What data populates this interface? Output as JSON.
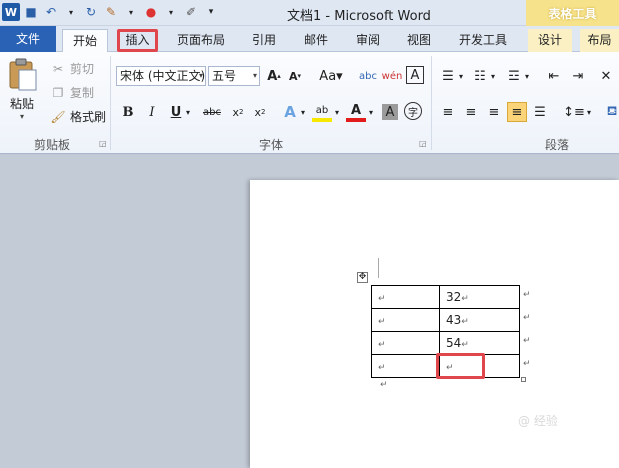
{
  "window": {
    "title": "文档1  -  Microsoft Word",
    "context_tab_group": "表格工具"
  },
  "quick_access": {
    "logo": "W"
  },
  "tabs": [
    {
      "label": "文件"
    },
    {
      "label": "开始"
    },
    {
      "label": "插入"
    },
    {
      "label": "页面布局"
    },
    {
      "label": "引用"
    },
    {
      "label": "邮件"
    },
    {
      "label": "审阅"
    },
    {
      "label": "视图"
    },
    {
      "label": "开发工具"
    },
    {
      "label": "设计"
    },
    {
      "label": "布局"
    }
  ],
  "clipboard": {
    "paste": "粘贴",
    "cut": "剪切",
    "copy": "复制",
    "format_painter": "格式刷",
    "group_label": "剪贴板"
  },
  "font": {
    "font_name": "宋体 (中文正文)",
    "font_size": "五号",
    "group_label": "字体"
  },
  "paragraph": {
    "group_label": "段落"
  },
  "table": {
    "rows": [
      [
        "",
        "32"
      ],
      [
        "",
        "43"
      ],
      [
        "",
        "54"
      ],
      [
        "",
        ""
      ]
    ],
    "cell_mark": "↵"
  },
  "watermark": "@ 经验"
}
